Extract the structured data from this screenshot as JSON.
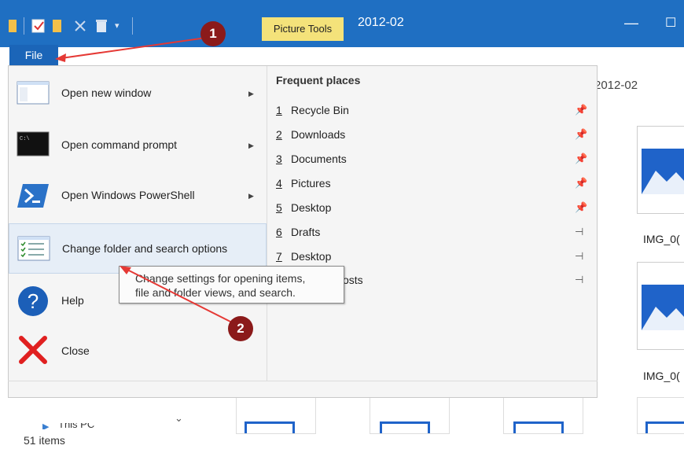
{
  "window": {
    "title": "2012-02",
    "context_tab": "Picture Tools",
    "file_tab": "File",
    "minimize_glyph": "—",
    "maximize_glyph": "☐"
  },
  "menu": {
    "items": [
      {
        "label": "Open new window",
        "icon": "new-window-icon",
        "has_submenu": true
      },
      {
        "label": "Open command prompt",
        "icon": "command-prompt-icon",
        "has_submenu": true
      },
      {
        "label": "Open Windows PowerShell",
        "icon": "powershell-icon",
        "has_submenu": true
      },
      {
        "label": "Change folder and search options",
        "icon": "folder-options-icon",
        "has_submenu": false
      },
      {
        "label": "Help",
        "icon": "help-icon",
        "has_submenu": false
      },
      {
        "label": "Close",
        "icon": "close-icon",
        "has_submenu": false
      }
    ],
    "frequent_places": {
      "title": "Frequent places",
      "items": [
        {
          "num": "1",
          "name": "Recycle Bin",
          "pinned": true
        },
        {
          "num": "2",
          "name": "Downloads",
          "pinned": true
        },
        {
          "num": "3",
          "name": "Documents",
          "pinned": true
        },
        {
          "num": "4",
          "name": "Pictures",
          "pinned": true
        },
        {
          "num": "5",
          "name": "Desktop",
          "pinned": true
        },
        {
          "num": "6",
          "name": "Drafts",
          "pinned": false
        },
        {
          "num": "7",
          "name": "Desktop",
          "pinned": false
        },
        {
          "num": "",
          "name": "osts",
          "pinned": false
        }
      ]
    }
  },
  "tooltip": {
    "line1": "Change settings for opening items,",
    "line2": "file and folder views, and search."
  },
  "background": {
    "address_fragment": "2012-02",
    "file_labels": [
      "IMG_0(",
      "IMG_0("
    ],
    "nav_fragment": "This PC"
  },
  "callouts": [
    "1",
    "2"
  ],
  "status": {
    "items": "51 items"
  },
  "colors": {
    "title_bar": "#1f6fc2",
    "picture_tools": "#f4e27a",
    "annotation": "#8b1a1a",
    "arrow": "#e53935"
  }
}
